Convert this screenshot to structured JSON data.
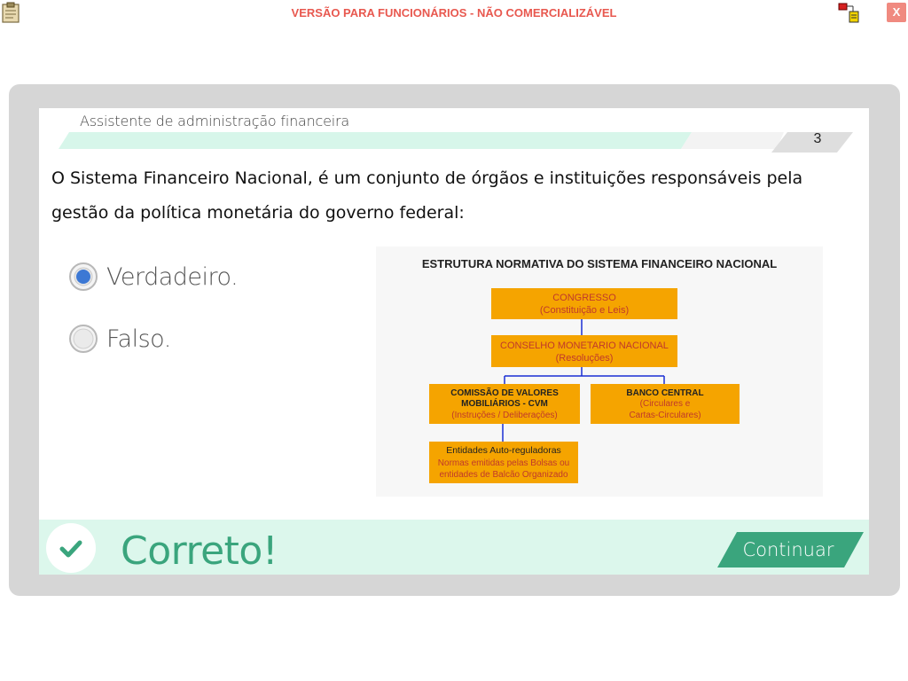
{
  "header": {
    "warning_text": "VERSÃO PARA FUNCIONÁRIOS - NÃO COMERCIALIZÁVEL",
    "close_label": "X"
  },
  "course": {
    "title": "Assistente de administração financeira",
    "page_number": "3"
  },
  "question": {
    "text": "O Sistema Financeiro Nacional, é um conjunto de órgãos e instituições responsáveis pela gestão da política monetária do governo federal:",
    "options": [
      {
        "label": "Verdadeiro.",
        "selected": true
      },
      {
        "label": "Falso.",
        "selected": false
      }
    ]
  },
  "diagram": {
    "title": "ESTRUTURA NORMATIVA DO SISTEMA FINANCEIRO NACIONAL",
    "box_color": "#f5a400",
    "text_color": "#c0392b",
    "line_color": "#1a2fd4",
    "congresso": {
      "name": "CONGRESSO",
      "sub": "(Constituição e Leis)"
    },
    "cmn": {
      "name": "CONSELHO MONETARIO NACIONAL",
      "sub": "(Resoluções)"
    },
    "cvm": {
      "name1": "COMISSÃO DE VALORES",
      "name2": "MOBILIÁRIOS - CVM",
      "sub": "(Instruções / Deliberações)"
    },
    "bc": {
      "name": "BANCO CENTRAL",
      "sub1": "(Circulares e",
      "sub2": "Cartas-Circulares)"
    },
    "auto": {
      "name": "Entidades Auto-reguladoras",
      "line1": "Normas emitidas pelas Bolsas ou",
      "line2": "entidades de Balcão Organizado"
    }
  },
  "feedback": {
    "result_label": "Correto!",
    "continue_label": "Continuar",
    "accent_color": "#3aa57d"
  }
}
